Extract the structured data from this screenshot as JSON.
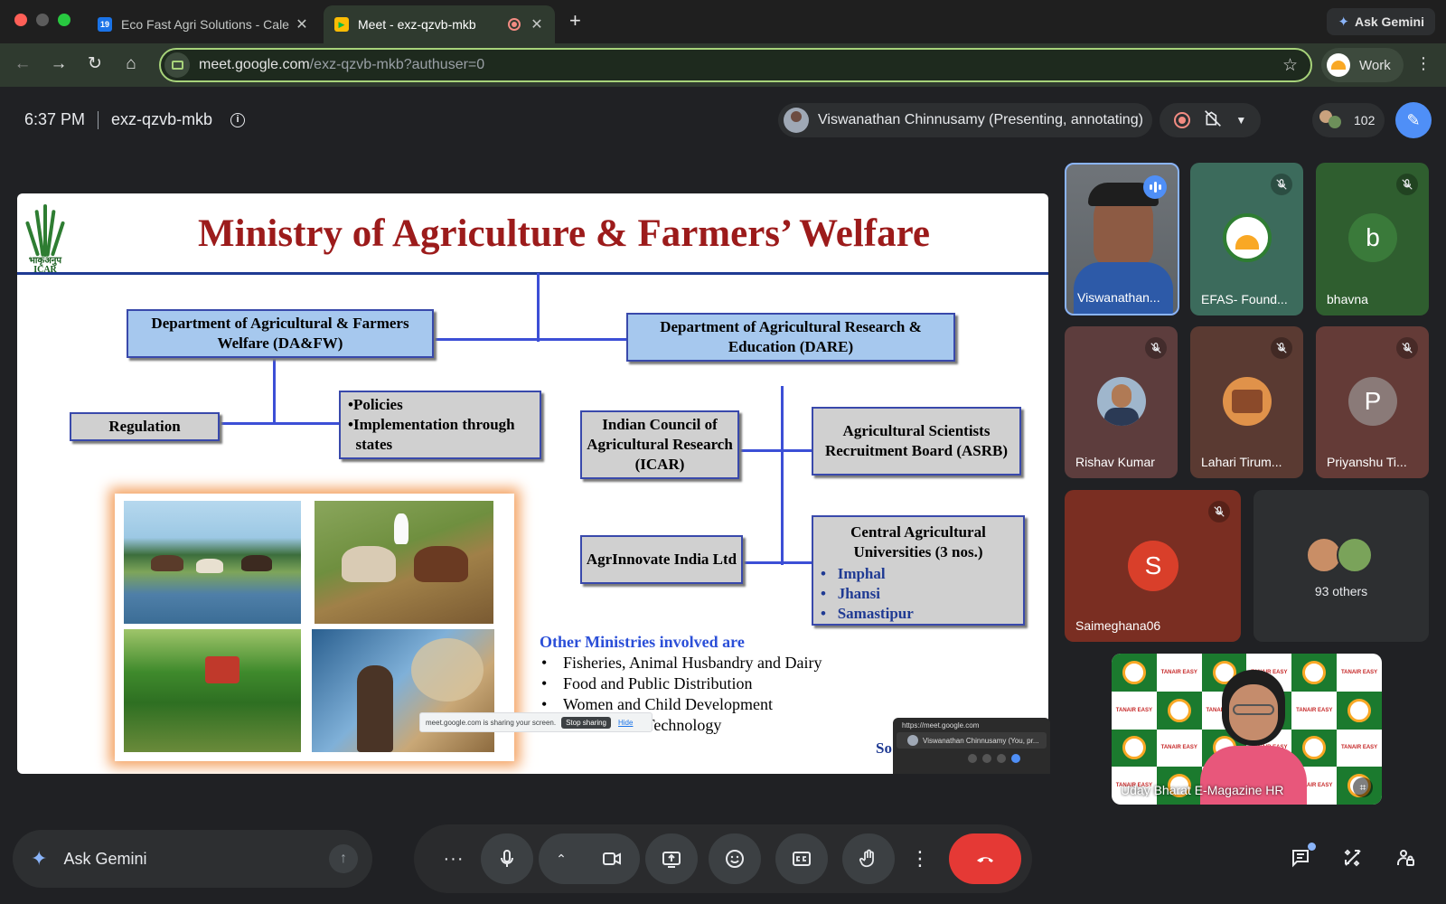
{
  "browser": {
    "tabs": [
      {
        "title": "Eco Fast Agri Solutions - Cale",
        "favicon": "calendar-icon",
        "favicon_text": "19"
      },
      {
        "title": "Meet - exz-qzvb-mkb",
        "favicon": "meet-icon"
      }
    ],
    "ask_gemini": "Ask Gemini",
    "url_host": "meet.google.com",
    "url_path": "/exz-qzvb-mkb?authuser=0",
    "profile_label": "Work"
  },
  "meeting": {
    "time": "6:37 PM",
    "code": "exz-qzvb-mkb",
    "presenter_status": "Viswanathan Chinnusamy (Presenting, annotating)",
    "participant_count": "102"
  },
  "slide": {
    "logo_text": "भाकृअनुप\nICAR",
    "title": "Ministry of Agriculture & Farmers’ Welfare",
    "da_fw": "Department of Agricultural & Farmers Welfare (DA&FW)",
    "dare": "Department of Agricultural Research & Education (DARE)",
    "regulation": "Regulation",
    "policies": [
      "•Policies",
      "•Implementation through",
      "  states"
    ],
    "icar": "Indian Council of Agricultural Research (ICAR)",
    "asrb": "Agricultural Scientists Recruitment Board (ASRB)",
    "agrinnovate": "AgrInnovate India Ltd",
    "cau_title": "Central Agricultural Universities (3 nos.)",
    "cau_items": [
      "Imphal",
      "Jhansi",
      "Samastipur"
    ],
    "other_title": "Other Ministries involved are",
    "other_items": [
      "Fisheries, Animal Husbandry and Dairy",
      "Food and Public Distribution",
      "Women and Child Development",
      "Science and Technology"
    ],
    "so_text": "So"
  },
  "screen_share": {
    "message": "meet.google.com is sharing your screen.",
    "stop_label": "Stop sharing",
    "hide_label": "Hide",
    "mini_url": "https://meet.google.com",
    "mini_presenter": "Viswanathan Chinnusamy (You, pr..."
  },
  "participants": [
    {
      "name": "Viswanathan...",
      "state": "speaking"
    },
    {
      "name": "EFAS- Found...",
      "state": "muted"
    },
    {
      "name": "bhavna",
      "initial": "b",
      "state": "muted"
    },
    {
      "name": "Rishav Kumar",
      "state": "muted"
    },
    {
      "name": "Lahari Tirum...",
      "state": "muted"
    },
    {
      "name": "Priyanshu Ti...",
      "initial": "P",
      "state": "muted"
    },
    {
      "name": "Saimeghana06",
      "initial": "S",
      "state": "muted"
    }
  ],
  "others_label": "93 others",
  "self_tile": {
    "name": "Uday Bharat E-Magazine HR",
    "pattern_text": "TANAIR EASY"
  },
  "bottom": {
    "ask_placeholder": "Ask Gemini",
    "controls": [
      "more-options",
      "microphone",
      "camera-options",
      "camera",
      "present-screen",
      "reactions",
      "captions",
      "raise-hand",
      "more-actions",
      "leave-call"
    ],
    "right_icons": [
      "chat-icon",
      "activities-icon",
      "host-controls-icon"
    ]
  },
  "colors": {
    "accent": "#8ab4f8",
    "hangup": "#e53935",
    "slide_title": "#9c1b1b",
    "box_blue": "#a6c8ee",
    "box_grey": "#d0d0d0"
  }
}
